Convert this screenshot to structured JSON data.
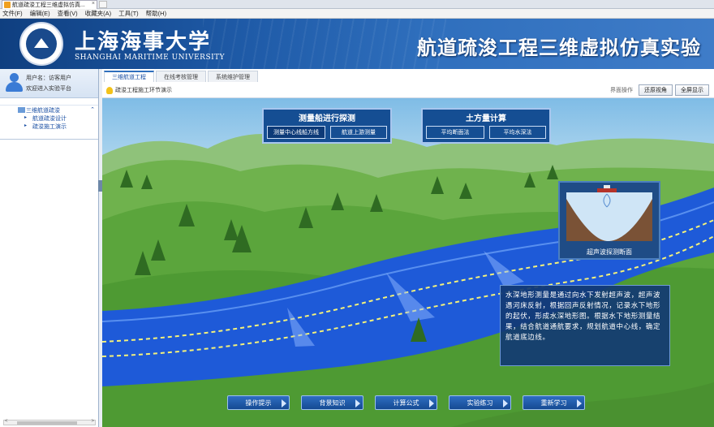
{
  "browser": {
    "tab_title": "航道疏浚工程三维虚拟仿真...",
    "tab_close": "×"
  },
  "menu": [
    "文件(F)",
    "编辑(E)",
    "查看(V)",
    "收藏夹(A)",
    "工具(T)",
    "帮助(H)"
  ],
  "banner": {
    "university_cn": "上海海事大学",
    "university_en": "SHANGHAI MARITIME UNIVERSITY",
    "system_title": "航道疏浚工程三维虚拟仿真实验"
  },
  "sidebar": {
    "user_line1": "用户名：访客用户",
    "user_line2": "欢迎进入实验平台",
    "nav_head": "三维航道疏浚",
    "items": [
      "航道疏浚设计",
      "疏浚施工演示"
    ]
  },
  "content": {
    "tabs": [
      "三维航道工程",
      "在线考核管理",
      "系统维护管理"
    ],
    "crumb": "疏浚工程施工环节演示",
    "tools_label": "界面操作",
    "btn_restore": "还原视角",
    "btn_fullscreen": "全屏显示"
  },
  "panels": {
    "survey": {
      "title": "测量船进行探测",
      "btn1": "测量中心线船方线",
      "btn2": "航道上游测量"
    },
    "earthwork": {
      "title": "土方量计算",
      "btn1": "平均断面法",
      "btn2": "平均水深法"
    }
  },
  "sonar": {
    "label": "超声波探测断面"
  },
  "info_text": "水深地形测量是通过向水下发射超声波，超声波遇河床反射，根据回声反射情况，记录水下地形的起伏，形成水深地形图。根据水下地形测量结果，结合航道通航要求，规划航道中心线，确定航道底边线。",
  "bottom_buttons": [
    "操作提示",
    "背景知识",
    "计算公式",
    "实验练习",
    "重新学习"
  ],
  "colors": {
    "banner": "#1f5ba8",
    "panel": "#154e93",
    "water": "#1e5ad8",
    "grass": "#5aa83a"
  }
}
